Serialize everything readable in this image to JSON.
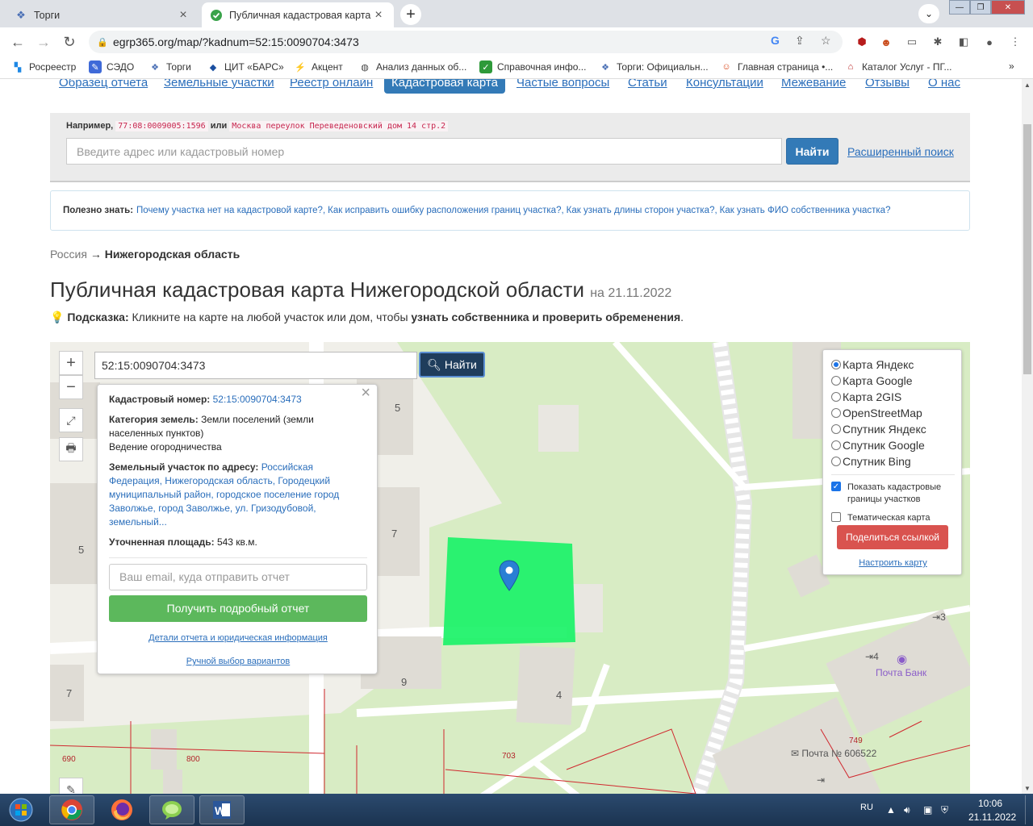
{
  "browser": {
    "tabs": [
      {
        "title": "Торги",
        "icon": "fns-emblem-icon"
      },
      {
        "title": "Публичная кадастровая карта Н",
        "icon": "check-circle-icon"
      }
    ],
    "url": "egrp365.org/map/?kadnum=52:15:0090704:3473",
    "bookmarks": [
      {
        "label": "Росреестр",
        "icon": "rosreestr-icon",
        "color": "#1e88e5"
      },
      {
        "label": "СЭДО",
        "icon": "sedo-icon",
        "color": "#3f6ad8"
      },
      {
        "label": "Торги",
        "icon": "fns-emblem-icon",
        "color": "#4a6fb5"
      },
      {
        "label": "ЦИТ «БАРС»",
        "icon": "bars-icon",
        "color": "#1a4fa0"
      },
      {
        "label": "Акцент",
        "icon": "akcent-icon",
        "color": "#2f45c9"
      },
      {
        "label": "Анализ данных об...",
        "icon": "globe-icon",
        "color": "#444444"
      },
      {
        "label": "Справочная инфо...",
        "icon": "spravka-icon",
        "color": "#2e9a3a"
      },
      {
        "label": "Торги: Официальн...",
        "icon": "fns-emblem-icon",
        "color": "#4a6fb5"
      },
      {
        "label": "Главная страница •...",
        "icon": "smile-icon",
        "color": "#d84315"
      },
      {
        "label": "Каталог Услуг - ПГ...",
        "icon": "catalog-icon",
        "color": "#b71c1c"
      }
    ]
  },
  "nav": {
    "items": [
      "Образец отчета",
      "Земельные участки",
      "Реестр онлайн",
      "Кадастровая карта",
      "Частые вопросы",
      "Статьи",
      "Консультации",
      "Межевание",
      "Отзывы",
      "О нас"
    ],
    "active": "Кадастровая карта"
  },
  "search": {
    "example_label": "Например,",
    "example_code1": "77:08:0009005:1596",
    "example_or": "или",
    "example_code2": "Москва переулок Переведеновский дом 14 стр.2",
    "placeholder": "Введите адрес или кадастровый номер",
    "button": "Найти",
    "advanced": "Расширенный поиск"
  },
  "useful": {
    "label": "Полезно знать:",
    "links": [
      "Почему участка нет на кадастровой карте?,",
      "Как исправить ошибку расположения границ участка?,",
      "Как узнать длины сторон участка?,",
      "Как узнать ФИО собственника участка?"
    ]
  },
  "breadcrumb": {
    "root": "Россия",
    "arrow": "→",
    "current": "Нижегородская область"
  },
  "title": {
    "main": "Публичная кадастровая карта Нижегородской области",
    "date": "на 21.11.2022"
  },
  "hint": {
    "label": "Подсказка:",
    "text1": "Кликните на карте на любой участок или дом, чтобы",
    "bold": "узнать собственника и проверить обременения",
    "text2": "."
  },
  "map": {
    "search_value": "52:15:0090704:3473",
    "search_button": "Найти",
    "zoom_in": "+",
    "zoom_out": "−",
    "popup": {
      "cad_label": "Кадастровый номер:",
      "cad_value": "52:15:0090704:3473",
      "cat_label": "Категория земель:",
      "cat_value": "Земли поселений (земли населенных пунктов)",
      "use_value": "Ведение огородничества",
      "addr_label": "Земельный участок по адресу:",
      "addr_value": "Российская Федерация, Нижегородская область, Городецкий муниципальный район, городское поселение город Заволжье, город Заволжье, ул. Гризодубовой, земельный...",
      "area_label": "Уточненная площадь:",
      "area_value": "543 кв.м.",
      "email_placeholder": "Ваш email, куда отправить отчет",
      "report_button": "Получить подробный отчет",
      "details_link": "Детали отчета и юридическая информация",
      "manual_link": "Ручной выбор вариантов"
    },
    "layers": {
      "options": [
        "Карта Яндекс",
        "Карта Google",
        "Карта 2GIS",
        "OpenStreetMap",
        "Спутник Яндекс",
        "Спутник Google",
        "Спутник Bing"
      ],
      "selected": "Карта Яндекс",
      "show_borders": "Показать кадастровые границы участков",
      "show_borders_checked": true,
      "thematic": "Тематическая карта",
      "thematic_checked": false,
      "share_button": "Поделиться ссылкой",
      "config_link": "Настроить карту"
    },
    "labels": {
      "house5a": "5",
      "house5b": "5",
      "house7a": "7",
      "house7b": "7",
      "house9": "9",
      "house4": "4",
      "num3": "3",
      "num4": "4",
      "bank": "Почта Банк",
      "post": "Почта № 606522",
      "c690": "690",
      "c800": "800",
      "c703": "703",
      "c749": "749"
    },
    "colors": {
      "parcel": "#21f26b",
      "marker": "#2a7fd4",
      "cadastral_lines": "#d0282e"
    }
  },
  "taskbar": {
    "apps": [
      "chrome-icon",
      "firefox-icon",
      "messenger-icon",
      "word-icon"
    ],
    "lang": "RU",
    "time": "10:06",
    "date": "21.11.2022"
  }
}
